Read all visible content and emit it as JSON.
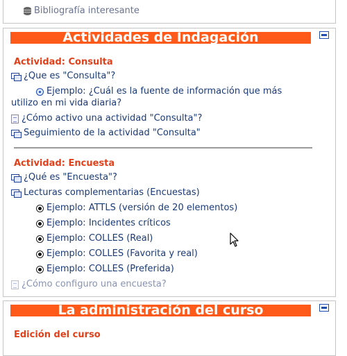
{
  "top": {
    "resource": {
      "label": "Bibliografía interesante",
      "icon": "database-icon"
    }
  },
  "indagacion": {
    "title": "Actividades de Indagación",
    "consulta": {
      "heading": "Actividad: Consulta",
      "items": [
        {
          "label": "¿Que es \"Consulta\"?",
          "icon": "forum-icon"
        },
        {
          "label_line1": "Ejemplo: ¿Cuál es la fuente de información que más",
          "label_line2": "utilizo en mi vida diaria?",
          "icon": "choice-icon"
        },
        {
          "label": "¿Cómo activo una actividad \"Consulta\"?",
          "icon": "page-icon"
        },
        {
          "label": "Seguimiento de la actividad \"Consulta\"",
          "icon": "forum-icon"
        }
      ]
    },
    "encuesta": {
      "heading": "Actividad: Encuesta",
      "items": [
        {
          "label": "¿Qué es \"Encuesta\"?",
          "icon": "forum-icon"
        },
        {
          "label": "Lecturas complementarias (Encuestas)",
          "icon": "forum-icon"
        },
        {
          "label": "Ejemplo: ATTLS (versión de 20 elementos)",
          "icon": "survey-icon"
        },
        {
          "label": "Ejemplo: Incidentes críticos",
          "icon": "survey-icon"
        },
        {
          "label": "Ejemplo: COLLES (Real)",
          "icon": "survey-icon"
        },
        {
          "label": "Ejemplo: COLLES (Favorita y real)",
          "icon": "survey-icon"
        },
        {
          "label": "Ejemplo: COLLES (Preferida)",
          "icon": "survey-icon"
        },
        {
          "label": "¿Cómo configuro una encuesta?",
          "icon": "page-icon"
        }
      ]
    }
  },
  "admin": {
    "title": "La administración del curso",
    "edicion": {
      "heading": "Edición del curso"
    }
  },
  "colors": {
    "header_bg": "#ff5a1a",
    "section_heading": "#e0401a",
    "link": "#1a3a78",
    "faded_link": "#8893b4"
  }
}
